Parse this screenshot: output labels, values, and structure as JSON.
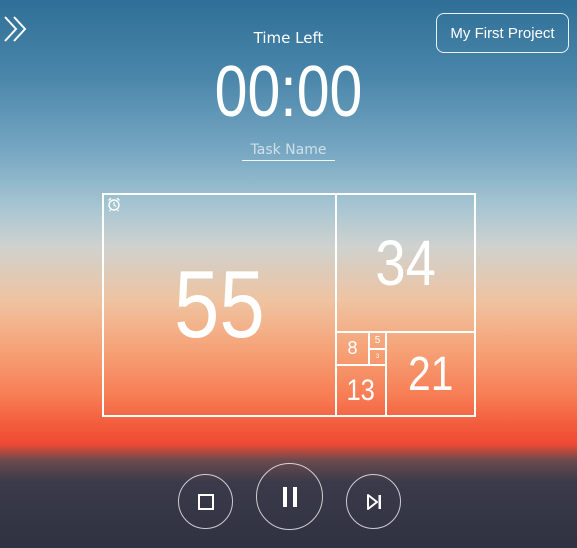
{
  "header": {
    "expand_icon": "double-chevron-right-icon",
    "project_button_label": "My First Project"
  },
  "timer": {
    "label": "Time Left",
    "value": "00:00",
    "task_placeholder": "Task Name"
  },
  "fibonacci": {
    "alarm_icon": "alarm-clock-icon",
    "cells": {
      "c55": "55",
      "c34": "34",
      "c21": "21",
      "c13": "13",
      "c8": "8",
      "c5": "5",
      "c3": "3"
    }
  },
  "controls": {
    "stop_icon": "stop-icon",
    "pause_icon": "pause-icon",
    "skip_icon": "skip-next-icon"
  }
}
